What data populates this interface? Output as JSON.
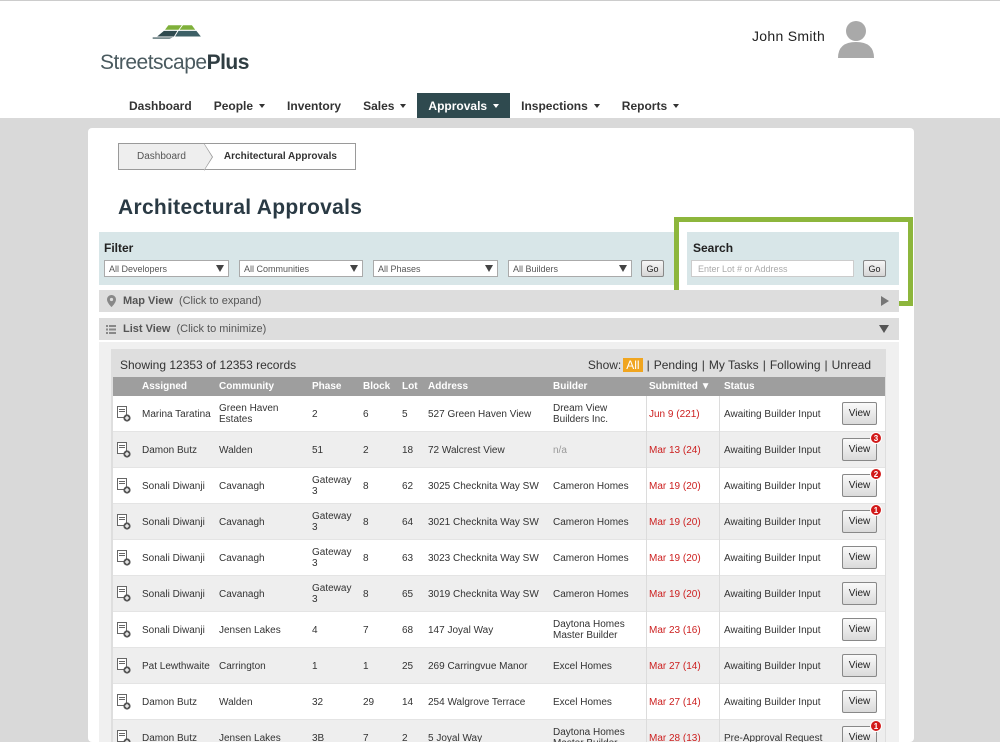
{
  "header": {
    "logo_text_part1": "Streetscape",
    "logo_text_part2": "Plus",
    "user_name": "John Smith"
  },
  "nav": [
    {
      "label": "Dashboard",
      "caret": false,
      "active": false
    },
    {
      "label": "People",
      "caret": true,
      "active": false
    },
    {
      "label": "Inventory",
      "caret": false,
      "active": false
    },
    {
      "label": "Sales",
      "caret": true,
      "active": false
    },
    {
      "label": "Approvals",
      "caret": true,
      "active": true
    },
    {
      "label": "Inspections",
      "caret": true,
      "active": false
    },
    {
      "label": "Reports",
      "caret": true,
      "active": false
    }
  ],
  "breadcrumb": {
    "home": "Dashboard",
    "current": "Architectural Approvals"
  },
  "page_title": "Architectural Approvals",
  "filter": {
    "title": "Filter",
    "developers": "All Developers",
    "communities": "All Communities",
    "phases": "All Phases",
    "builders": "All Builders",
    "go": "Go"
  },
  "search": {
    "title": "Search",
    "placeholder": "Enter Lot # or Address",
    "go": "Go"
  },
  "map_view": {
    "label": "Map View",
    "note": "(Click to expand)"
  },
  "list_view": {
    "label": "List View",
    "note": "(Click to minimize)"
  },
  "showing": "Showing 12353 of 12353 records",
  "show_filter": {
    "label": "Show:",
    "all": "All",
    "pending": "Pending",
    "my_tasks": "My Tasks",
    "following": "Following",
    "unread": "Unread"
  },
  "columns": {
    "assigned": "Assigned",
    "community": "Community",
    "phase": "Phase",
    "block": "Block",
    "lot": "Lot",
    "address": "Address",
    "builder": "Builder",
    "submitted": "Submitted ▼",
    "status": "Status"
  },
  "view_label": "View",
  "rows": [
    {
      "assigned": "Marina Taratina",
      "community": "Green Haven Estates",
      "phase": "2",
      "block": "6",
      "lot": "5",
      "address": "527 Green Haven View",
      "builder": "Dream View Builders Inc.",
      "submitted": "Jun 9 (221)",
      "status": "Awaiting Builder Input",
      "badge": ""
    },
    {
      "assigned": "Damon Butz",
      "community": "Walden",
      "phase": "51",
      "block": "2",
      "lot": "18",
      "address": "72 Walcrest View",
      "builder": "n/a",
      "submitted": "Mar 13 (24)",
      "status": "Awaiting Builder Input",
      "badge": "3"
    },
    {
      "assigned": "Sonali Diwanji",
      "community": "Cavanagh",
      "phase": "Gateway 3",
      "block": "8",
      "lot": "62",
      "address": "3025 Checknita Way SW",
      "builder": "Cameron Homes",
      "submitted": "Mar 19 (20)",
      "status": "Awaiting Builder Input",
      "badge": "2"
    },
    {
      "assigned": "Sonali Diwanji",
      "community": "Cavanagh",
      "phase": "Gateway 3",
      "block": "8",
      "lot": "64",
      "address": "3021 Checknita Way SW",
      "builder": "Cameron Homes",
      "submitted": "Mar 19 (20)",
      "status": "Awaiting Builder Input",
      "badge": "1"
    },
    {
      "assigned": "Sonali Diwanji",
      "community": "Cavanagh",
      "phase": "Gateway 3",
      "block": "8",
      "lot": "63",
      "address": "3023 Checknita Way SW",
      "builder": "Cameron Homes",
      "submitted": "Mar 19 (20)",
      "status": "Awaiting Builder Input",
      "badge": ""
    },
    {
      "assigned": "Sonali Diwanji",
      "community": "Cavanagh",
      "phase": "Gateway 3",
      "block": "8",
      "lot": "65",
      "address": "3019 Checknita Way SW",
      "builder": "Cameron Homes",
      "submitted": "Mar 19 (20)",
      "status": "Awaiting Builder Input",
      "badge": ""
    },
    {
      "assigned": "Sonali Diwanji",
      "community": "Jensen Lakes",
      "phase": "4",
      "block": "7",
      "lot": "68",
      "address": "147 Joyal Way",
      "builder": "Daytona Homes Master Builder",
      "submitted": "Mar 23 (16)",
      "status": "Awaiting Builder Input",
      "badge": ""
    },
    {
      "assigned": "Pat Lewthwaite",
      "community": "Carrington",
      "phase": "1",
      "block": "1",
      "lot": "25",
      "address": "269 Carringvue Manor",
      "builder": "Excel Homes",
      "submitted": "Mar 27 (14)",
      "status": "Awaiting Builder Input",
      "badge": ""
    },
    {
      "assigned": "Damon Butz",
      "community": "Walden",
      "phase": "32",
      "block": "29",
      "lot": "14",
      "address": "254 Walgrove Terrace",
      "builder": "Excel Homes",
      "submitted": "Mar 27 (14)",
      "status": "Awaiting Builder Input",
      "badge": ""
    },
    {
      "assigned": "Damon Butz",
      "community": "Jensen Lakes",
      "phase": "3B",
      "block": "7",
      "lot": "2",
      "address": "5 Joyal Way",
      "builder": "Daytona Homes Master Builder",
      "submitted": "Mar 28 (13)",
      "status": "Pre-Approval Request",
      "badge": "1"
    }
  ],
  "colors": {
    "accent_nav": "#2f4a4f",
    "search_highlight": "#8db63c",
    "date_red": "#cc1f1f",
    "badge_red": "#d21a1a",
    "all_orange": "#f0a51f"
  }
}
